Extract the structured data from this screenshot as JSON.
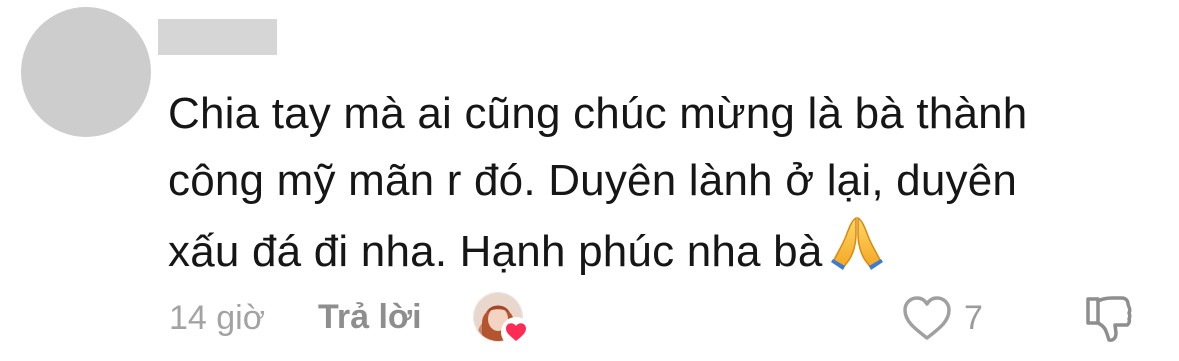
{
  "comment": {
    "lines": [
      "Chia tay mà ai cũng chúc mừng là bà thành",
      "công mỹ mãn r đó. Duyên lành ở lại, duyên",
      "xấu đá đi nha. Hạnh phúc nha bà"
    ],
    "emoji": "folded-hands-emoji"
  },
  "footer": {
    "timestamp": "14 giờ",
    "reply_label": "Trả lời",
    "like_count": "7"
  },
  "icons": {
    "like": "heart-outline-icon",
    "dislike": "thumbs-down-icon",
    "creator_liked": "heart-filled-icon"
  },
  "colors": {
    "avatar_placeholder": "#cdcdcd",
    "text": "#161616",
    "muted": "#a3a3a3",
    "heart_accent": "#fe2c55"
  }
}
